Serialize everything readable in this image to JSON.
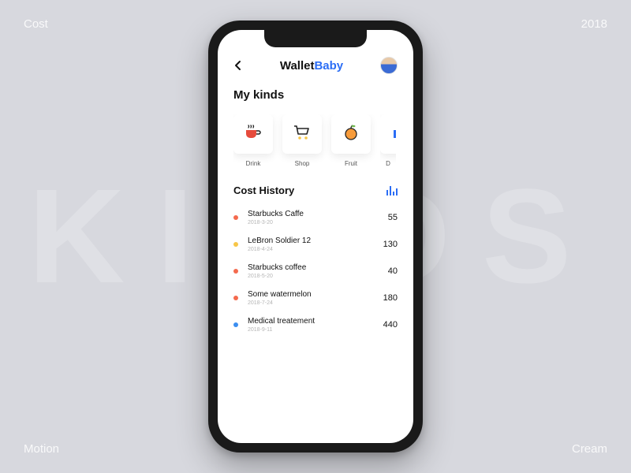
{
  "corners": {
    "tl": "Cost",
    "tr": "2018",
    "bl": "Motion",
    "br": "Cream"
  },
  "bg_word": "KINDS",
  "app": {
    "name_a": "Wallet",
    "name_b": "Baby"
  },
  "sections": {
    "kinds_title": "My kinds",
    "history_title": "Cost History"
  },
  "kinds": [
    {
      "label": "Drink",
      "icon": "cup"
    },
    {
      "label": "Shop",
      "icon": "cart"
    },
    {
      "label": "Fruit",
      "icon": "fruit"
    },
    {
      "label": "D",
      "icon": "generic"
    }
  ],
  "history": [
    {
      "name": "Starbucks Caffe",
      "date": "2018-3-20",
      "amount": "55",
      "color": "#f46a4e"
    },
    {
      "name": "LeBron Soldier 12",
      "date": "2018-4-24",
      "amount": "130",
      "color": "#f7c648"
    },
    {
      "name": "Starbucks coffee",
      "date": "2018-5-20",
      "amount": "40",
      "color": "#f46a4e"
    },
    {
      "name": "Some watermelon",
      "date": "2018-7-24",
      "amount": "180",
      "color": "#f46a4e"
    },
    {
      "name": "Medical treatement",
      "date": "2018-9-11",
      "amount": "440",
      "color": "#3b8ef0"
    }
  ]
}
